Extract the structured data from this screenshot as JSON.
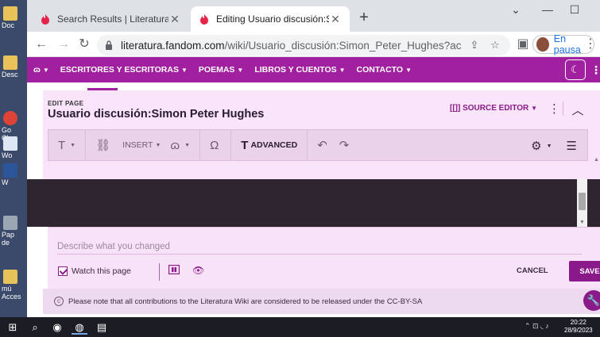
{
  "desktop": {
    "icons": [
      {
        "label": "Doc",
        "color": "#e8c35a"
      },
      {
        "label": "Desc",
        "color": "#e8c35a"
      },
      {
        "label": "Go Chr",
        "color": "#db4437"
      },
      {
        "label": "Wo",
        "color": "#2b579a"
      },
      {
        "label": "W",
        "color": "#2b579a"
      },
      {
        "label": "Pap de",
        "color": "#9aa6b2"
      },
      {
        "label": "mú Acces",
        "color": "#e8c35a"
      }
    ]
  },
  "browser": {
    "tabs": [
      {
        "title": "Search Results | Literatura Wiki | Fa",
        "active": false
      },
      {
        "title": "Editing Usuario discusión:Simon Pe",
        "active": true
      }
    ],
    "url": "literatura.fandom.com",
    "url_path": "/wiki/Usuario_discusión:Simon_Peter_Hughes?action=edit&...",
    "profile_label": "En pausa",
    "accent": "#1a73e8"
  },
  "site": {
    "brand_color": "#a020a0",
    "nav_items": [
      "ESCRITORES Y ESCRITORAS",
      "POEMAS",
      "LIBROS Y CUENTOS",
      "CONTACTO"
    ]
  },
  "editor": {
    "kicker": "EDIT PAGE",
    "title": "Usuario discusión:Simon Peter Hughes",
    "source_editor": "SOURCE EDITOR",
    "toolbar": {
      "insert": "INSERT",
      "advanced": "ADVANCED"
    }
  },
  "save_panel": {
    "summary_placeholder": "Describe what you changed",
    "watch_label": "Watch this page",
    "cancel": "CANCEL",
    "save": "SAVE"
  },
  "license_text": "Please note that all contributions to the Literatura Wiki are considered to be released under the CC-BY-SA",
  "taskbar": {
    "time": "20:22",
    "date": "28/9/2023"
  }
}
